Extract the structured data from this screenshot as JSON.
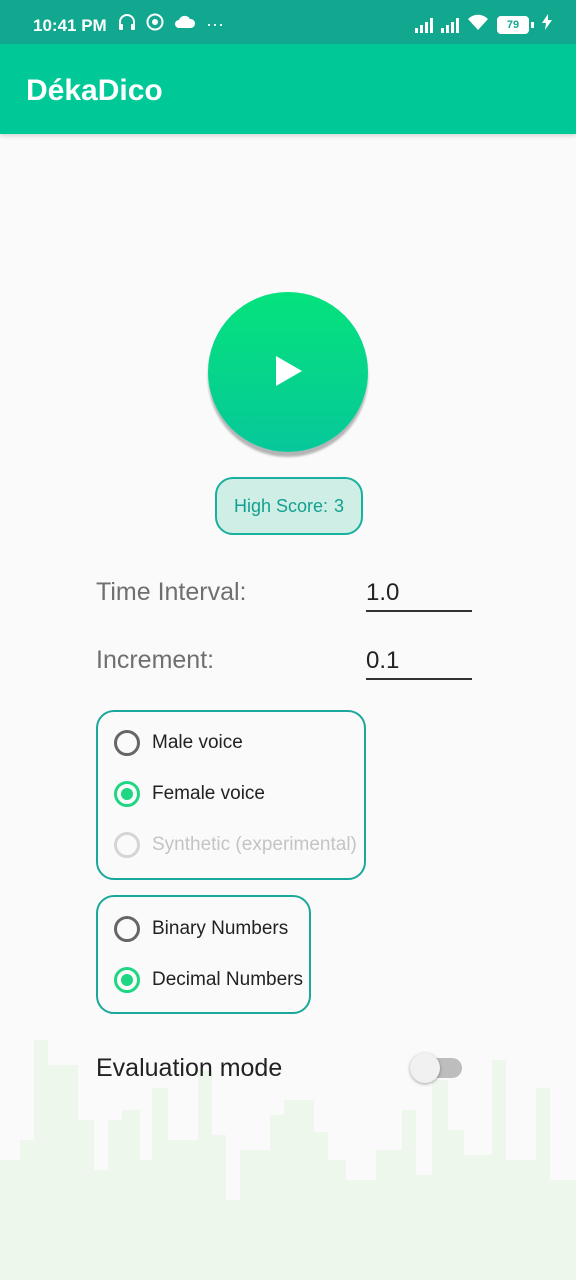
{
  "status_bar": {
    "time": "10:41 PM",
    "icons": [
      "headphones-icon",
      "target-icon",
      "cloud-icon",
      "more-dots-icon"
    ],
    "battery": "79",
    "more": "···"
  },
  "app_bar": {
    "title": "DékaDico"
  },
  "play_button": {
    "icon": "play-icon"
  },
  "high_score": {
    "label": "High Score:",
    "value": "3"
  },
  "fields": {
    "time_interval": {
      "label": "Time Interval:",
      "value": "1.0"
    },
    "increment": {
      "label": "Increment:",
      "value": "0.1"
    }
  },
  "voice_group": {
    "options": [
      {
        "label": "Male voice",
        "checked": false,
        "disabled": false
      },
      {
        "label": "Female voice",
        "checked": true,
        "disabled": false
      },
      {
        "label": "Synthetic (experimental)",
        "checked": false,
        "disabled": true
      }
    ]
  },
  "number_group": {
    "options": [
      {
        "label": "Binary Numbers",
        "checked": false
      },
      {
        "label": "Decimal Numbers",
        "checked": true
      }
    ]
  },
  "evaluation": {
    "label": "Evaluation mode",
    "enabled": false
  },
  "colors": {
    "primary": "#00c896",
    "status_bar": "#12a890",
    "accent": "#1fd682",
    "outline": "#1aa89a"
  }
}
